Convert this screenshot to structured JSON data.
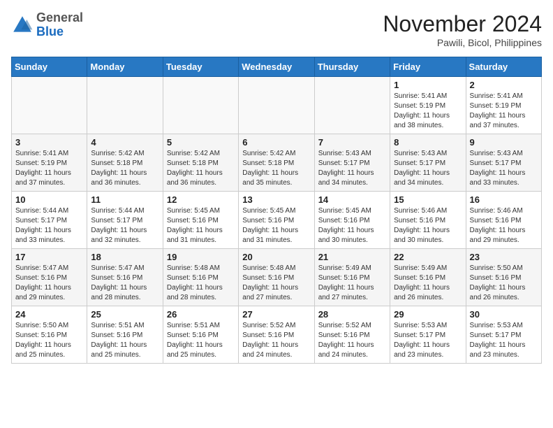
{
  "header": {
    "logo": {
      "general": "General",
      "blue": "Blue"
    },
    "month": "November 2024",
    "location": "Pawili, Bicol, Philippines"
  },
  "weekdays": [
    "Sunday",
    "Monday",
    "Tuesday",
    "Wednesday",
    "Thursday",
    "Friday",
    "Saturday"
  ],
  "weeks": [
    [
      {
        "day": "",
        "info": ""
      },
      {
        "day": "",
        "info": ""
      },
      {
        "day": "",
        "info": ""
      },
      {
        "day": "",
        "info": ""
      },
      {
        "day": "",
        "info": ""
      },
      {
        "day": "1",
        "info": "Sunrise: 5:41 AM\nSunset: 5:19 PM\nDaylight: 11 hours\nand 38 minutes."
      },
      {
        "day": "2",
        "info": "Sunrise: 5:41 AM\nSunset: 5:19 PM\nDaylight: 11 hours\nand 37 minutes."
      }
    ],
    [
      {
        "day": "3",
        "info": "Sunrise: 5:41 AM\nSunset: 5:19 PM\nDaylight: 11 hours\nand 37 minutes."
      },
      {
        "day": "4",
        "info": "Sunrise: 5:42 AM\nSunset: 5:18 PM\nDaylight: 11 hours\nand 36 minutes."
      },
      {
        "day": "5",
        "info": "Sunrise: 5:42 AM\nSunset: 5:18 PM\nDaylight: 11 hours\nand 36 minutes."
      },
      {
        "day": "6",
        "info": "Sunrise: 5:42 AM\nSunset: 5:18 PM\nDaylight: 11 hours\nand 35 minutes."
      },
      {
        "day": "7",
        "info": "Sunrise: 5:43 AM\nSunset: 5:17 PM\nDaylight: 11 hours\nand 34 minutes."
      },
      {
        "day": "8",
        "info": "Sunrise: 5:43 AM\nSunset: 5:17 PM\nDaylight: 11 hours\nand 34 minutes."
      },
      {
        "day": "9",
        "info": "Sunrise: 5:43 AM\nSunset: 5:17 PM\nDaylight: 11 hours\nand 33 minutes."
      }
    ],
    [
      {
        "day": "10",
        "info": "Sunrise: 5:44 AM\nSunset: 5:17 PM\nDaylight: 11 hours\nand 33 minutes."
      },
      {
        "day": "11",
        "info": "Sunrise: 5:44 AM\nSunset: 5:17 PM\nDaylight: 11 hours\nand 32 minutes."
      },
      {
        "day": "12",
        "info": "Sunrise: 5:45 AM\nSunset: 5:16 PM\nDaylight: 11 hours\nand 31 minutes."
      },
      {
        "day": "13",
        "info": "Sunrise: 5:45 AM\nSunset: 5:16 PM\nDaylight: 11 hours\nand 31 minutes."
      },
      {
        "day": "14",
        "info": "Sunrise: 5:45 AM\nSunset: 5:16 PM\nDaylight: 11 hours\nand 30 minutes."
      },
      {
        "day": "15",
        "info": "Sunrise: 5:46 AM\nSunset: 5:16 PM\nDaylight: 11 hours\nand 30 minutes."
      },
      {
        "day": "16",
        "info": "Sunrise: 5:46 AM\nSunset: 5:16 PM\nDaylight: 11 hours\nand 29 minutes."
      }
    ],
    [
      {
        "day": "17",
        "info": "Sunrise: 5:47 AM\nSunset: 5:16 PM\nDaylight: 11 hours\nand 29 minutes."
      },
      {
        "day": "18",
        "info": "Sunrise: 5:47 AM\nSunset: 5:16 PM\nDaylight: 11 hours\nand 28 minutes."
      },
      {
        "day": "19",
        "info": "Sunrise: 5:48 AM\nSunset: 5:16 PM\nDaylight: 11 hours\nand 28 minutes."
      },
      {
        "day": "20",
        "info": "Sunrise: 5:48 AM\nSunset: 5:16 PM\nDaylight: 11 hours\nand 27 minutes."
      },
      {
        "day": "21",
        "info": "Sunrise: 5:49 AM\nSunset: 5:16 PM\nDaylight: 11 hours\nand 27 minutes."
      },
      {
        "day": "22",
        "info": "Sunrise: 5:49 AM\nSunset: 5:16 PM\nDaylight: 11 hours\nand 26 minutes."
      },
      {
        "day": "23",
        "info": "Sunrise: 5:50 AM\nSunset: 5:16 PM\nDaylight: 11 hours\nand 26 minutes."
      }
    ],
    [
      {
        "day": "24",
        "info": "Sunrise: 5:50 AM\nSunset: 5:16 PM\nDaylight: 11 hours\nand 25 minutes."
      },
      {
        "day": "25",
        "info": "Sunrise: 5:51 AM\nSunset: 5:16 PM\nDaylight: 11 hours\nand 25 minutes."
      },
      {
        "day": "26",
        "info": "Sunrise: 5:51 AM\nSunset: 5:16 PM\nDaylight: 11 hours\nand 25 minutes."
      },
      {
        "day": "27",
        "info": "Sunrise: 5:52 AM\nSunset: 5:16 PM\nDaylight: 11 hours\nand 24 minutes."
      },
      {
        "day": "28",
        "info": "Sunrise: 5:52 AM\nSunset: 5:16 PM\nDaylight: 11 hours\nand 24 minutes."
      },
      {
        "day": "29",
        "info": "Sunrise: 5:53 AM\nSunset: 5:17 PM\nDaylight: 11 hours\nand 23 minutes."
      },
      {
        "day": "30",
        "info": "Sunrise: 5:53 AM\nSunset: 5:17 PM\nDaylight: 11 hours\nand 23 minutes."
      }
    ]
  ]
}
